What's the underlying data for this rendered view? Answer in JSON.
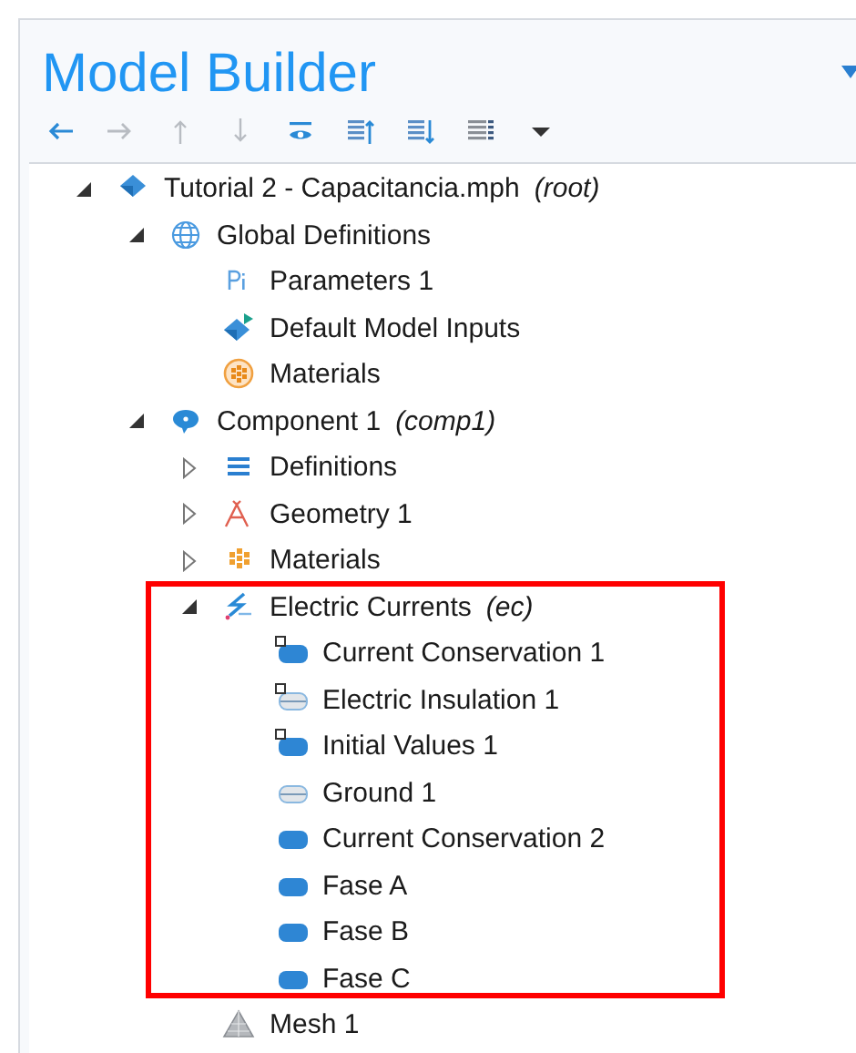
{
  "panel": {
    "title": "Model Builder"
  },
  "toolbar": [
    {
      "kind": "back",
      "disabled": false
    },
    {
      "kind": "forward",
      "disabled": true
    },
    {
      "kind": "up",
      "disabled": true
    },
    {
      "kind": "down",
      "disabled": true
    },
    {
      "kind": "show",
      "disabled": false
    },
    {
      "kind": "expand-all"
    },
    {
      "kind": "collapse-all"
    },
    {
      "kind": "list"
    },
    {
      "kind": "menu"
    }
  ],
  "tree": [
    {
      "label": "Tutorial 2 - Capacitancia.mph",
      "tag": "(root)",
      "kind": "model",
      "expanded": true,
      "children": [
        {
          "label": "Global Definitions",
          "kind": "globe",
          "expanded": true,
          "children": [
            {
              "label": "Parameters 1",
              "kind": "parameters"
            },
            {
              "label": "Default Model Inputs",
              "kind": "inputs"
            },
            {
              "label": "Materials",
              "kind": "materials-round"
            }
          ]
        },
        {
          "label": "Component 1",
          "tag": "(comp1)",
          "kind": "component",
          "expanded": true,
          "children": [
            {
              "label": "Definitions",
              "kind": "definitions",
              "expanded": false
            },
            {
              "label": "Geometry 1",
              "kind": "geometry",
              "expanded": false
            },
            {
              "label": "Materials",
              "kind": "materials",
              "expanded": false
            },
            {
              "label": "Electric Currents",
              "tag": "(ec)",
              "kind": "physics",
              "expanded": true,
              "highlighted": true,
              "children": [
                {
                  "label": "Current Conservation 1",
                  "kind": "domain",
                  "default": true
                },
                {
                  "label": "Electric Insulation 1",
                  "kind": "boundary",
                  "default": true
                },
                {
                  "label": "Initial Values 1",
                  "kind": "domain",
                  "default": true
                },
                {
                  "label": "Ground 1",
                  "kind": "boundary",
                  "default": false
                },
                {
                  "label": "Current Conservation 2",
                  "kind": "domain",
                  "default": false
                },
                {
                  "label": "Fase A",
                  "kind": "domain",
                  "default": false
                },
                {
                  "label": "Fase B",
                  "kind": "domain",
                  "default": false
                },
                {
                  "label": "Fase C",
                  "kind": "domain",
                  "default": false
                }
              ]
            },
            {
              "label": "Mesh 1",
              "kind": "mesh"
            }
          ]
        }
      ]
    }
  ]
}
